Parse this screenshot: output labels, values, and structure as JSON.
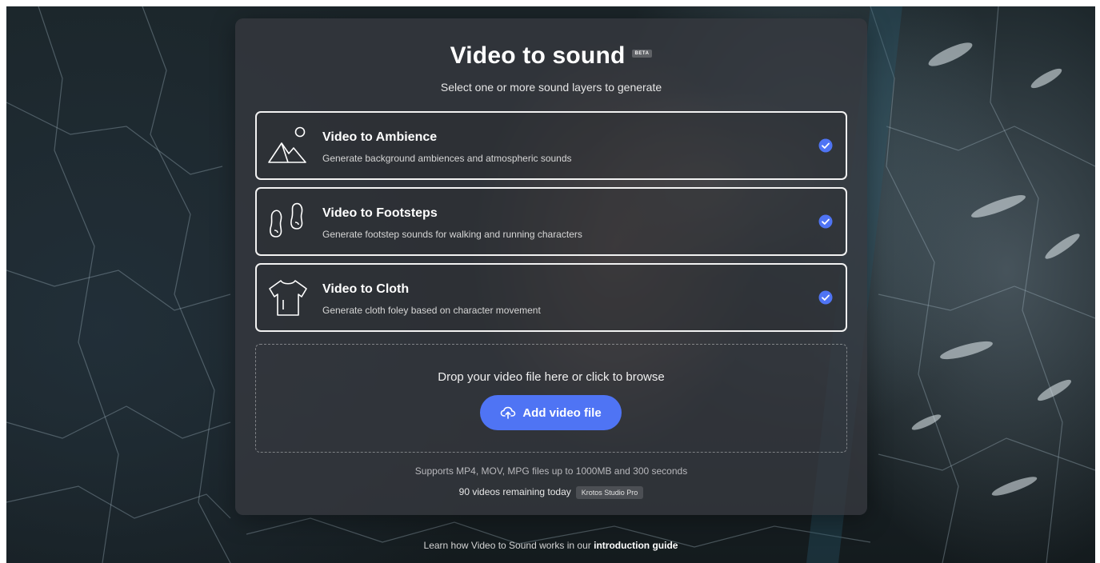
{
  "header": {
    "title": "Video to sound",
    "beta_badge": "BETA",
    "subtitle": "Select one or more sound layers to generate"
  },
  "options": [
    {
      "title": "Video to Ambience",
      "description": "Generate background ambiences and atmospheric sounds",
      "icon": "mountain-sun-icon",
      "selected": true
    },
    {
      "title": "Video to Footsteps",
      "description": "Generate footstep sounds for walking and running characters",
      "icon": "footprints-icon",
      "selected": true
    },
    {
      "title": "Video to Cloth",
      "description": "Generate cloth foley based on character movement",
      "icon": "tshirt-icon",
      "selected": true
    }
  ],
  "dropzone": {
    "text": "Drop your video file here or click to browse",
    "button_label": "Add video file",
    "button_icon": "cloud-upload-icon"
  },
  "info": {
    "supports": "Supports MP4, MOV, MPG files up to 1000MB and 300 seconds",
    "remaining": "90 videos remaining today",
    "plan": "Krotos Studio Pro"
  },
  "footer": {
    "text": "Learn how Video to Sound works in our",
    "link": "introduction guide"
  },
  "colors": {
    "accent": "#4f74f4",
    "check": "#4f74f4",
    "panel": "#36383e"
  }
}
